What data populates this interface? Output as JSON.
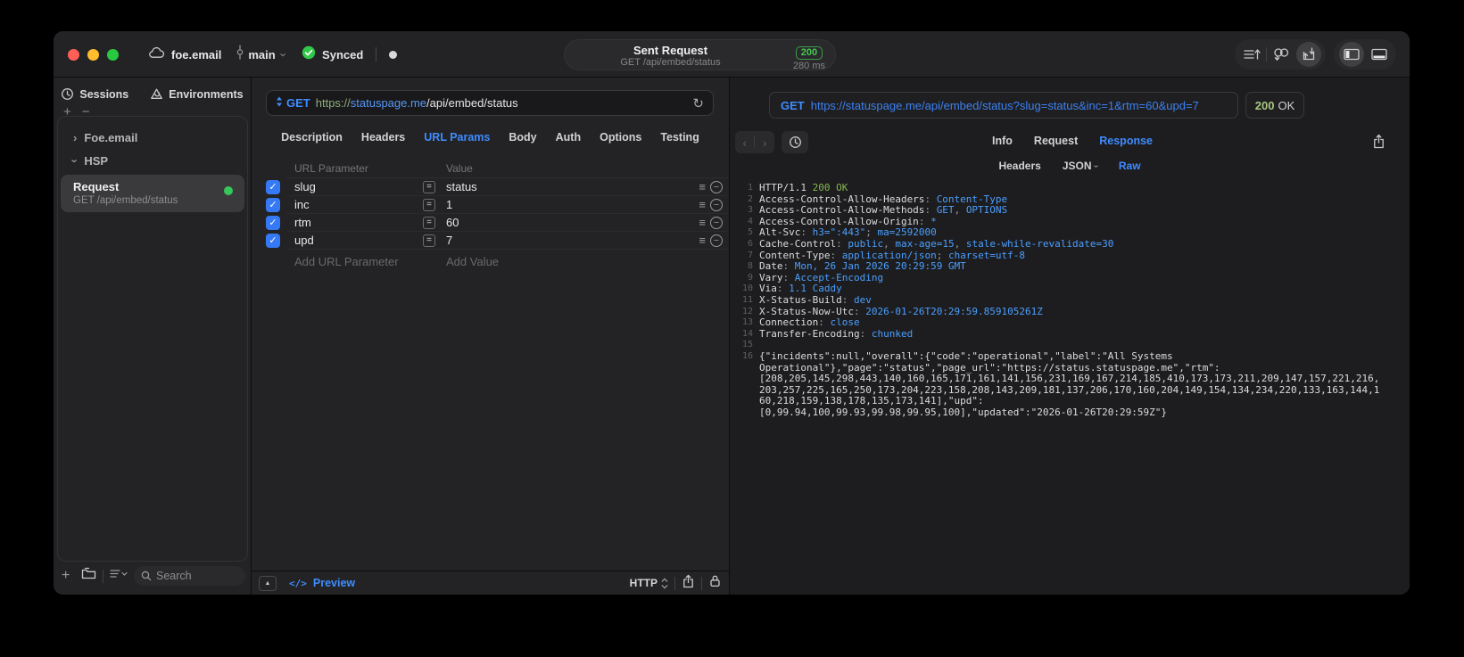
{
  "titlebar": {
    "project": "foe.email",
    "branch": "main",
    "sync_label": "Synced",
    "title": "Sent Request",
    "subtitle": "GET /api/embed/status",
    "status_badge": "200",
    "duration": "280 ms"
  },
  "icons": {
    "plus": "+",
    "minus": "−",
    "check": "✓",
    "hamburger": "≡",
    "collapse": "▲",
    "refresh": "↻",
    "chevron_right": "›",
    "back": "‹",
    "forward": "›",
    "code": "</>",
    "equals": "="
  },
  "sidebar": {
    "tabs": [
      {
        "label": "Sessions"
      },
      {
        "label": "Environments"
      }
    ],
    "tree": [
      {
        "label": "Foe.email",
        "expanded": false
      },
      {
        "label": "HSP",
        "expanded": true
      },
      {
        "label": "Request",
        "subtitle": "GET /api/embed/status",
        "selected": true,
        "status_dot": "green"
      }
    ],
    "search_placeholder": "Search"
  },
  "request_pane": {
    "method": "GET",
    "url_scheme": "https://",
    "url_host": "statuspage.me",
    "url_path": "/api/embed/status",
    "tabs": [
      "Description",
      "Headers",
      "URL Params",
      "Body",
      "Auth",
      "Options",
      "Testing"
    ],
    "active_tab": "URL Params",
    "params_table": {
      "columns": [
        "URL Parameter",
        "Value"
      ],
      "rows": [
        {
          "enabled": true,
          "name": "slug",
          "value": "status"
        },
        {
          "enabled": true,
          "name": "inc",
          "value": "1"
        },
        {
          "enabled": true,
          "name": "rtm",
          "value": "60"
        },
        {
          "enabled": true,
          "name": "upd",
          "value": "7"
        }
      ],
      "add_name_placeholder": "Add URL Parameter",
      "add_value_placeholder": "Add Value"
    },
    "footer": {
      "preview_label": "Preview",
      "protocol": "HTTP"
    }
  },
  "response_pane": {
    "method": "GET",
    "url": "https://statuspage.me/api/embed/status?slug=status&inc=1&rtm=60&upd=7",
    "status_code": "200",
    "status_text": "OK",
    "tabs": [
      "Info",
      "Request",
      "Response"
    ],
    "active_tab": "Response",
    "subtabs": [
      "Headers",
      "JSON",
      "Raw"
    ],
    "active_subtab": "Raw",
    "code_lines": [
      {
        "n": "1",
        "parts": [
          [
            "cw",
            "HTTP/1.1 "
          ],
          [
            "cg",
            "200 OK"
          ]
        ]
      },
      {
        "n": "2",
        "parts": [
          [
            "cw",
            "Access-Control-Allow-Headers"
          ],
          [
            "cd",
            ": "
          ],
          [
            "cb",
            "Content-Type"
          ]
        ]
      },
      {
        "n": "3",
        "parts": [
          [
            "cw",
            "Access-Control-Allow-Methods"
          ],
          [
            "cd",
            ": "
          ],
          [
            "cb",
            "GET"
          ],
          [
            "cd",
            ", "
          ],
          [
            "cb",
            "OPTIONS"
          ]
        ]
      },
      {
        "n": "4",
        "parts": [
          [
            "cw",
            "Access-Control-Allow-Origin"
          ],
          [
            "cd",
            ": "
          ],
          [
            "cb",
            "*"
          ]
        ]
      },
      {
        "n": "5",
        "parts": [
          [
            "cw",
            "Alt-Svc"
          ],
          [
            "cd",
            ": "
          ],
          [
            "cb",
            "h3=\":443\""
          ],
          [
            "cd",
            "; "
          ],
          [
            "cb",
            "ma=2592000"
          ]
        ]
      },
      {
        "n": "6",
        "parts": [
          [
            "cw",
            "Cache-Control"
          ],
          [
            "cd",
            ": "
          ],
          [
            "cb",
            "public"
          ],
          [
            "cd",
            ", "
          ],
          [
            "cb",
            "max-age=15"
          ],
          [
            "cd",
            ", "
          ],
          [
            "cb",
            "stale-while-revalidate=30"
          ]
        ]
      },
      {
        "n": "7",
        "parts": [
          [
            "cw",
            "Content-Type"
          ],
          [
            "cd",
            ": "
          ],
          [
            "cb",
            "application/json"
          ],
          [
            "cd",
            "; "
          ],
          [
            "cb",
            "charset=utf-8"
          ]
        ]
      },
      {
        "n": "8",
        "parts": [
          [
            "cw",
            "Date"
          ],
          [
            "cd",
            ": "
          ],
          [
            "cb",
            "Mon, 26 Jan 2026 20:29:59 GMT"
          ]
        ]
      },
      {
        "n": "9",
        "parts": [
          [
            "cw",
            "Vary"
          ],
          [
            "cd",
            ": "
          ],
          [
            "cb",
            "Accept-Encoding"
          ]
        ]
      },
      {
        "n": "10",
        "parts": [
          [
            "cw",
            "Via"
          ],
          [
            "cd",
            ": "
          ],
          [
            "cb",
            "1.1 Caddy"
          ]
        ]
      },
      {
        "n": "11",
        "parts": [
          [
            "cw",
            "X-Status-Build"
          ],
          [
            "cd",
            ": "
          ],
          [
            "cb",
            "dev"
          ]
        ]
      },
      {
        "n": "12",
        "parts": [
          [
            "cw",
            "X-Status-Now-Utc"
          ],
          [
            "cd",
            ": "
          ],
          [
            "cb",
            "2026-01-26T20:29:59.859105261Z"
          ]
        ]
      },
      {
        "n": "13",
        "parts": [
          [
            "cw",
            "Connection"
          ],
          [
            "cd",
            ": "
          ],
          [
            "cb",
            "close"
          ]
        ]
      },
      {
        "n": "14",
        "parts": [
          [
            "cw",
            "Transfer-Encoding"
          ],
          [
            "cd",
            ": "
          ],
          [
            "cb",
            "chunked"
          ]
        ]
      },
      {
        "n": "15",
        "parts": []
      },
      {
        "n": "16",
        "parts": [
          [
            "cw",
            "{\"incidents\":null,\"overall\":{\"code\":\"operational\",\"label\":\"All Systems"
          ]
        ]
      },
      {
        "n": "",
        "parts": [
          [
            "cw",
            "Operational\"},\"page\":\"status\",\"page_url\":\"https://status.statuspage.me\",\"rtm\":"
          ]
        ]
      },
      {
        "n": "",
        "parts": [
          [
            "cw",
            "[208,205,145,298,443,140,160,165,171,161,141,156,231,169,167,214,185,410,173,173,211,209,147,157,221,216,"
          ]
        ]
      },
      {
        "n": "",
        "parts": [
          [
            "cw",
            "203,257,225,165,250,173,204,223,158,208,143,209,181,137,206,170,160,204,149,154,134,234,220,133,163,144,1"
          ]
        ]
      },
      {
        "n": "",
        "parts": [
          [
            "cw",
            "60,218,159,138,178,135,173,141],\"upd\":"
          ]
        ]
      },
      {
        "n": "",
        "parts": [
          [
            "cw",
            "[0,99.94,100,99.93,99.98,99.95,100],\"updated\":\"2026-01-26T20:29:59Z\"}"
          ]
        ]
      }
    ]
  },
  "colors": {
    "accent_blue": "#3f8cff",
    "badge_green": "#47c655",
    "status_dot_green": "#34c759",
    "code_value_blue": "#4b9fff",
    "code_status_green": "#84b84e",
    "checkbox_blue": "#3679f6"
  }
}
